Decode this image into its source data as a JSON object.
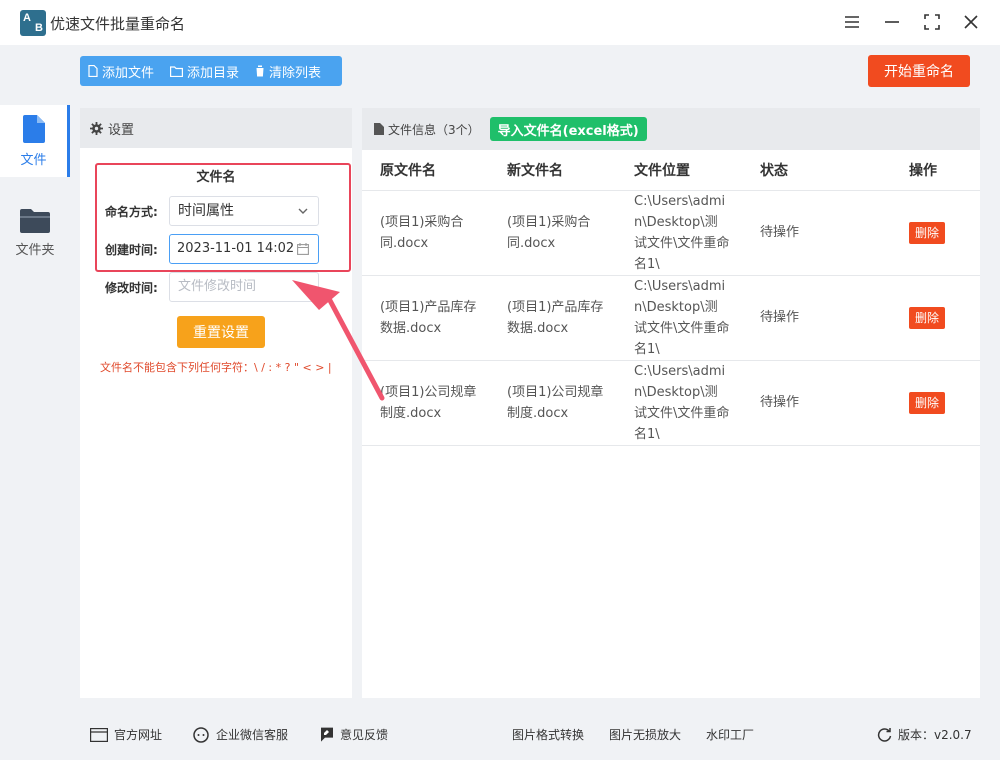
{
  "app": {
    "title": "优速文件批量重命名",
    "logo_top": "A",
    "logo_bottom": "B"
  },
  "sidebar": {
    "items": [
      {
        "label": "文件",
        "icon": "file-icon",
        "active": true
      },
      {
        "label": "文件夹",
        "icon": "folder-icon",
        "active": false
      }
    ]
  },
  "toolbar": {
    "add_file": "添加文件",
    "add_dir": "添加目录",
    "clear_list": "清除列表",
    "start_rename": "开始重命名"
  },
  "settings": {
    "header": "设置",
    "section_title": "文件名",
    "naming_mode_label": "命名方式:",
    "naming_mode_value": "时间属性",
    "created_label": "创建时间:",
    "created_value": "2023-11-01 14:02",
    "modified_label": "修改时间:",
    "modified_placeholder": "文件修改时间",
    "reset_button": "重置设置",
    "warning": "文件名不能包含下列任何字符：\\ / : * ? \" < > |"
  },
  "files": {
    "header_label": "文件信息（3个）",
    "import_button": "导入文件名(excel格式)",
    "columns": [
      "原文件名",
      "新文件名",
      "文件位置",
      "状态",
      "操作"
    ],
    "rows": [
      {
        "original": "(项目1)采购合同.docx",
        "new": "(项目1)采购合同.docx",
        "location": "C:\\Users\\admin\\Desktop\\测试文件\\文件重命名1\\",
        "status": "待操作",
        "action": "删除"
      },
      {
        "original": "(项目1)产品库存数据.docx",
        "new": "(项目1)产品库存数据.docx",
        "location": "C:\\Users\\admin\\Desktop\\测试文件\\文件重命名1\\",
        "status": "待操作",
        "action": "删除"
      },
      {
        "original": "(项目1)公司规章制度.docx",
        "new": "(项目1)公司规章制度.docx",
        "location": "C:\\Users\\admin\\Desktop\\测试文件\\文件重命名1\\",
        "status": "待操作",
        "action": "删除"
      }
    ]
  },
  "footer": {
    "website": "官方网址",
    "wechat_support": "企业微信客服",
    "feedback": "意见反馈",
    "image_convert": "图片格式转换",
    "image_upscale": "图片无损放大",
    "watermark": "水印工厂",
    "version": "版本：v2.0.7"
  },
  "colors": {
    "accent_blue": "#4aa3f0",
    "start_red": "#f14b1f",
    "reset_orange": "#f7a21b",
    "import_green": "#1fbf6a",
    "highlight_box": "#e9455a"
  }
}
